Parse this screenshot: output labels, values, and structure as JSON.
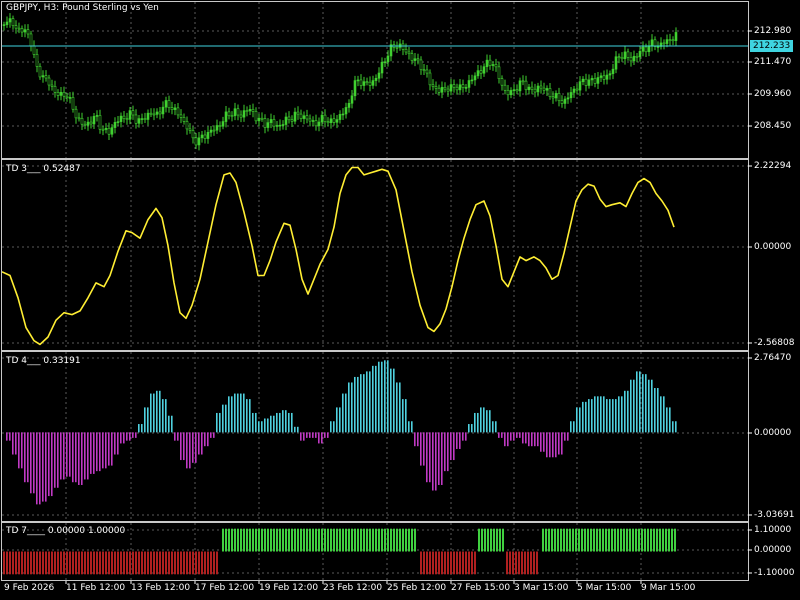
{
  "symbol_label": "GBPJPY, H3:  Pound Sterling vs Yen",
  "current_price": "212.233",
  "colors": {
    "background": "#000000",
    "grid": "#5a5a5a",
    "bull_candle": "#40d030",
    "price_line": "#3fd4e0",
    "td3_line": "#ffee33",
    "td4_positive": "#4fd1df",
    "td4_negative": "#c03ac4",
    "td7_positive": "#40d040",
    "td7_negative": "#b02020"
  },
  "price_axis": {
    "ticks": [
      "212.980",
      "211.470",
      "209.960",
      "208.450"
    ],
    "range": [
      207.2,
      213.6
    ]
  },
  "td3": {
    "label": "TD 3___ 0.52487",
    "ticks": [
      "2.22294",
      "0.00000",
      "-2.56808"
    ],
    "range": [
      -2.7,
      2.4
    ]
  },
  "td4": {
    "label": "TD 4___ 0.33191",
    "ticks": [
      "2.76470",
      "0.00000",
      "-3.03691"
    ],
    "range": [
      -3.2,
      2.9
    ]
  },
  "td7": {
    "label": "TD 7____ 0.00000 1.00000",
    "ticks": [
      "1.10000",
      "0.00000",
      "-1.10000"
    ],
    "range": [
      -1.25,
      1.25
    ]
  },
  "time_axis": {
    "labels": [
      "9 Feb 2026",
      "11 Feb 12:00",
      "13 Feb 12:00",
      "17 Feb 12:00",
      "19 Feb 12:00",
      "23 Feb 12:00",
      "25 Feb 12:00",
      "27 Feb 15:00",
      "3 Mar 15:00",
      "5 Mar 15:00",
      "9 Mar 15:00"
    ]
  },
  "chart_data": {
    "type": "line",
    "price_close_points": [
      [
        0,
        212.6
      ],
      [
        6,
        212.9
      ],
      [
        12,
        212.7
      ],
      [
        18,
        212.5
      ],
      [
        24,
        212.4
      ],
      [
        30,
        212.2
      ],
      [
        36,
        210.9
      ],
      [
        42,
        210.6
      ],
      [
        48,
        210.3
      ],
      [
        54,
        210.0
      ],
      [
        60,
        209.7
      ],
      [
        66,
        209.9
      ],
      [
        72,
        209.3
      ],
      [
        78,
        208.8
      ],
      [
        84,
        208.5
      ],
      [
        90,
        208.7
      ],
      [
        96,
        208.9
      ],
      [
        102,
        208.4
      ],
      [
        108,
        208.2
      ],
      [
        114,
        208.6
      ],
      [
        120,
        208.8
      ],
      [
        126,
        208.9
      ],
      [
        132,
        209.0
      ],
      [
        138,
        208.7
      ],
      [
        144,
        208.8
      ],
      [
        150,
        209.1
      ],
      [
        156,
        208.9
      ],
      [
        162,
        209.3
      ],
      [
        168,
        209.4
      ],
      [
        174,
        209.2
      ],
      [
        180,
        208.9
      ],
      [
        186,
        208.6
      ],
      [
        192,
        208.0
      ],
      [
        198,
        207.9
      ],
      [
        204,
        208.1
      ],
      [
        210,
        208.3
      ],
      [
        216,
        208.4
      ],
      [
        222,
        208.7
      ],
      [
        228,
        209.0
      ],
      [
        234,
        209.1
      ],
      [
        240,
        208.9
      ],
      [
        246,
        209.2
      ],
      [
        252,
        209.1
      ],
      [
        258,
        208.8
      ],
      [
        264,
        208.6
      ],
      [
        270,
        208.7
      ],
      [
        276,
        208.5
      ],
      [
        282,
        208.6
      ],
      [
        288,
        208.8
      ],
      [
        294,
        208.9
      ],
      [
        300,
        209.0
      ],
      [
        306,
        208.8
      ],
      [
        312,
        208.7
      ],
      [
        318,
        208.6
      ],
      [
        324,
        208.9
      ],
      [
        330,
        208.6
      ],
      [
        336,
        208.8
      ],
      [
        342,
        209.0
      ],
      [
        348,
        209.3
      ],
      [
        354,
        210.2
      ],
      [
        360,
        210.4
      ],
      [
        366,
        210.2
      ],
      [
        372,
        210.3
      ],
      [
        378,
        210.6
      ],
      [
        384,
        211.2
      ],
      [
        390,
        211.6
      ],
      [
        396,
        211.9
      ],
      [
        402,
        211.7
      ],
      [
        408,
        211.5
      ],
      [
        414,
        211.2
      ],
      [
        420,
        211.1
      ],
      [
        426,
        210.6
      ],
      [
        432,
        210.2
      ],
      [
        438,
        209.9
      ],
      [
        444,
        210.1
      ],
      [
        450,
        210.0
      ],
      [
        456,
        210.2
      ],
      [
        462,
        210.0
      ],
      [
        468,
        210.3
      ],
      [
        474,
        210.5
      ],
      [
        480,
        210.8
      ],
      [
        486,
        211.0
      ],
      [
        492,
        211.2
      ],
      [
        498,
        210.6
      ],
      [
        504,
        210.0
      ],
      [
        510,
        209.8
      ],
      [
        516,
        210.1
      ],
      [
        522,
        210.3
      ],
      [
        528,
        210.1
      ],
      [
        534,
        209.9
      ],
      [
        540,
        210.2
      ],
      [
        546,
        209.9
      ],
      [
        552,
        209.8
      ],
      [
        558,
        209.6
      ],
      [
        564,
        209.5
      ],
      [
        570,
        209.8
      ],
      [
        576,
        210.1
      ],
      [
        582,
        210.3
      ],
      [
        588,
        210.4
      ],
      [
        594,
        210.3
      ],
      [
        600,
        210.6
      ],
      [
        606,
        210.4
      ],
      [
        612,
        210.9
      ],
      [
        618,
        211.3
      ],
      [
        624,
        211.5
      ],
      [
        630,
        211.2
      ],
      [
        636,
        211.4
      ],
      [
        642,
        211.6
      ],
      [
        648,
        211.8
      ],
      [
        654,
        211.9
      ],
      [
        660,
        211.8
      ],
      [
        666,
        212.0
      ],
      [
        672,
        212.1
      ],
      [
        676,
        212.2
      ]
    ],
    "td3_points": [
      [
        2,
        -0.6
      ],
      [
        10,
        -0.7
      ],
      [
        18,
        -1.3
      ],
      [
        26,
        -2.1
      ],
      [
        34,
        -2.45
      ],
      [
        40,
        -2.55
      ],
      [
        48,
        -2.35
      ],
      [
        56,
        -1.9
      ],
      [
        64,
        -1.7
      ],
      [
        72,
        -1.75
      ],
      [
        80,
        -1.65
      ],
      [
        88,
        -1.3
      ],
      [
        96,
        -0.9
      ],
      [
        104,
        -1.0
      ],
      [
        110,
        -0.7
      ],
      [
        118,
        -0.05
      ],
      [
        126,
        0.5
      ],
      [
        132,
        0.45
      ],
      [
        140,
        0.3
      ],
      [
        148,
        0.8
      ],
      [
        156,
        1.1
      ],
      [
        162,
        0.85
      ],
      [
        168,
        0.1
      ],
      [
        174,
        -0.9
      ],
      [
        180,
        -1.7
      ],
      [
        186,
        -1.85
      ],
      [
        192,
        -1.5
      ],
      [
        200,
        -0.8
      ],
      [
        208,
        0.2
      ],
      [
        216,
        1.2
      ],
      [
        224,
        2.0
      ],
      [
        230,
        2.05
      ],
      [
        236,
        1.8
      ],
      [
        244,
        1.0
      ],
      [
        252,
        0.1
      ],
      [
        258,
        -0.7
      ],
      [
        264,
        -0.7
      ],
      [
        270,
        -0.3
      ],
      [
        276,
        0.2
      ],
      [
        284,
        0.7
      ],
      [
        290,
        0.65
      ],
      [
        296,
        0.0
      ],
      [
        302,
        -0.8
      ],
      [
        308,
        -1.2
      ],
      [
        314,
        -0.8
      ],
      [
        320,
        -0.4
      ],
      [
        328,
        0.0
      ],
      [
        334,
        0.6
      ],
      [
        340,
        1.5
      ],
      [
        346,
        2.0
      ],
      [
        352,
        2.2
      ],
      [
        358,
        2.2
      ],
      [
        364,
        2.0
      ],
      [
        370,
        2.05
      ],
      [
        376,
        2.1
      ],
      [
        382,
        2.15
      ],
      [
        388,
        2.1
      ],
      [
        396,
        1.6
      ],
      [
        404,
        0.5
      ],
      [
        412,
        -0.6
      ],
      [
        420,
        -1.5
      ],
      [
        428,
        -2.1
      ],
      [
        434,
        -2.2
      ],
      [
        440,
        -2.0
      ],
      [
        446,
        -1.6
      ],
      [
        452,
        -1.0
      ],
      [
        458,
        -0.3
      ],
      [
        464,
        0.3
      ],
      [
        470,
        0.8
      ],
      [
        476,
        1.2
      ],
      [
        484,
        1.3
      ],
      [
        490,
        0.9
      ],
      [
        496,
        0.1
      ],
      [
        502,
        -0.8
      ],
      [
        508,
        -1.0
      ],
      [
        514,
        -0.6
      ],
      [
        520,
        -0.2
      ],
      [
        526,
        -0.3
      ],
      [
        534,
        -0.2
      ],
      [
        540,
        -0.3
      ],
      [
        546,
        -0.5
      ],
      [
        552,
        -0.8
      ],
      [
        558,
        -0.7
      ],
      [
        564,
        -0.1
      ],
      [
        570,
        0.6
      ],
      [
        576,
        1.3
      ],
      [
        582,
        1.6
      ],
      [
        588,
        1.75
      ],
      [
        594,
        1.7
      ],
      [
        600,
        1.35
      ],
      [
        606,
        1.15
      ],
      [
        612,
        1.2
      ],
      [
        620,
        1.25
      ],
      [
        626,
        1.15
      ],
      [
        632,
        1.5
      ],
      [
        638,
        1.8
      ],
      [
        644,
        1.9
      ],
      [
        650,
        1.8
      ],
      [
        656,
        1.5
      ],
      [
        662,
        1.3
      ],
      [
        668,
        1.05
      ],
      [
        674,
        0.6
      ]
    ],
    "td4_bars": [
      [
        8,
        -0.3
      ],
      [
        14,
        -0.8
      ],
      [
        20,
        -1.3
      ],
      [
        26,
        -1.8
      ],
      [
        32,
        -2.2
      ],
      [
        38,
        -2.6
      ],
      [
        44,
        -2.5
      ],
      [
        50,
        -2.3
      ],
      [
        56,
        -2.0
      ],
      [
        62,
        -1.7
      ],
      [
        68,
        -1.6
      ],
      [
        74,
        -1.8
      ],
      [
        80,
        -1.9
      ],
      [
        86,
        -1.7
      ],
      [
        92,
        -1.5
      ],
      [
        98,
        -1.4
      ],
      [
        104,
        -1.3
      ],
      [
        110,
        -1.2
      ],
      [
        116,
        -0.8
      ],
      [
        122,
        -0.4
      ],
      [
        128,
        -0.3
      ],
      [
        134,
        -0.2
      ],
      [
        140,
        0.3
      ],
      [
        146,
        0.9
      ],
      [
        152,
        1.4
      ],
      [
        158,
        1.5
      ],
      [
        164,
        1.2
      ],
      [
        170,
        0.6
      ],
      [
        176,
        -0.3
      ],
      [
        182,
        -1.0
      ],
      [
        188,
        -1.3
      ],
      [
        194,
        -1.1
      ],
      [
        200,
        -0.8
      ],
      [
        206,
        -0.5
      ],
      [
        212,
        -0.2
      ],
      [
        218,
        0.7
      ],
      [
        224,
        1.0
      ],
      [
        230,
        1.3
      ],
      [
        236,
        1.4
      ],
      [
        242,
        1.4
      ],
      [
        248,
        1.2
      ],
      [
        254,
        0.7
      ],
      [
        260,
        0.4
      ],
      [
        266,
        0.5
      ],
      [
        272,
        0.6
      ],
      [
        278,
        0.7
      ],
      [
        284,
        0.8
      ],
      [
        290,
        0.7
      ],
      [
        296,
        0.2
      ],
      [
        302,
        -0.3
      ],
      [
        308,
        -0.2
      ],
      [
        314,
        -0.2
      ],
      [
        320,
        -0.4
      ],
      [
        326,
        -0.2
      ],
      [
        332,
        0.4
      ],
      [
        338,
        0.9
      ],
      [
        344,
        1.4
      ],
      [
        350,
        1.8
      ],
      [
        356,
        2.0
      ],
      [
        362,
        2.1
      ],
      [
        368,
        2.2
      ],
      [
        374,
        2.4
      ],
      [
        380,
        2.55
      ],
      [
        386,
        2.6
      ],
      [
        392,
        2.3
      ],
      [
        398,
        1.8
      ],
      [
        404,
        1.2
      ],
      [
        410,
        0.4
      ],
      [
        416,
        -0.5
      ],
      [
        422,
        -1.2
      ],
      [
        428,
        -1.8
      ],
      [
        434,
        -2.1
      ],
      [
        440,
        -1.9
      ],
      [
        446,
        -1.4
      ],
      [
        452,
        -1.0
      ],
      [
        458,
        -0.6
      ],
      [
        464,
        -0.3
      ],
      [
        470,
        0.3
      ],
      [
        476,
        0.7
      ],
      [
        482,
        0.9
      ],
      [
        488,
        0.8
      ],
      [
        494,
        0.4
      ],
      [
        500,
        -0.2
      ],
      [
        506,
        -0.5
      ],
      [
        512,
        -0.3
      ],
      [
        518,
        -0.2
      ],
      [
        524,
        -0.4
      ],
      [
        530,
        -0.5
      ],
      [
        536,
        -0.5
      ],
      [
        542,
        -0.7
      ],
      [
        548,
        -0.9
      ],
      [
        554,
        -0.9
      ],
      [
        560,
        -0.8
      ],
      [
        566,
        -0.3
      ],
      [
        572,
        0.4
      ],
      [
        578,
        0.9
      ],
      [
        584,
        1.1
      ],
      [
        590,
        1.2
      ],
      [
        596,
        1.3
      ],
      [
        602,
        1.3
      ],
      [
        608,
        1.2
      ],
      [
        614,
        1.2
      ],
      [
        620,
        1.3
      ],
      [
        626,
        1.5
      ],
      [
        632,
        1.9
      ],
      [
        638,
        2.2
      ],
      [
        644,
        2.1
      ],
      [
        650,
        1.9
      ],
      [
        656,
        1.6
      ],
      [
        662,
        1.3
      ],
      [
        668,
        0.9
      ],
      [
        674,
        0.4
      ]
    ],
    "td7_segments": [
      {
        "start": 3,
        "end": 216,
        "value": -1
      },
      {
        "start": 222,
        "end": 416,
        "value": 1
      },
      {
        "start": 420,
        "end": 474,
        "value": -1
      },
      {
        "start": 478,
        "end": 502,
        "value": 1
      },
      {
        "start": 506,
        "end": 538,
        "value": -1
      },
      {
        "start": 542,
        "end": 674,
        "value": 1
      }
    ]
  }
}
